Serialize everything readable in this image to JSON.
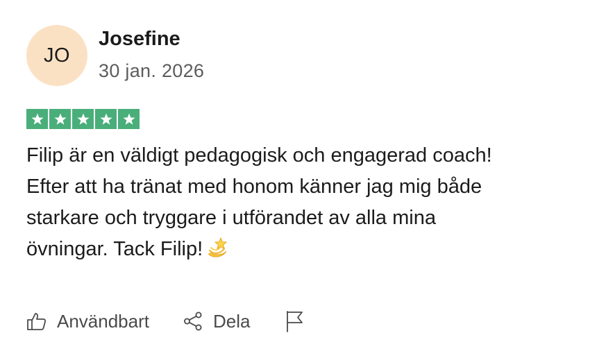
{
  "review": {
    "avatar_initials": "JO",
    "author_name": "Josefine",
    "date": "30 jan. 2026",
    "rating": 5,
    "rating_max": 5,
    "text": "Filip är en väldigt pedagogisk och engagerad coach! Efter att ha tränat med honom känner jag mig både starkare och tryggare i utförandet av alla mina övningar. Tack Filip!",
    "emoji_icon": "dizzy-star-icon"
  },
  "actions": {
    "useful_label": "Användbart",
    "share_label": "Dela",
    "useful_icon": "thumbs-up-icon",
    "share_icon": "share-icon",
    "report_icon": "flag-icon"
  },
  "colors": {
    "star_green": "#4aae7a",
    "avatar_bg": "#fbe1c3",
    "muted_text": "#5c5c5c"
  }
}
